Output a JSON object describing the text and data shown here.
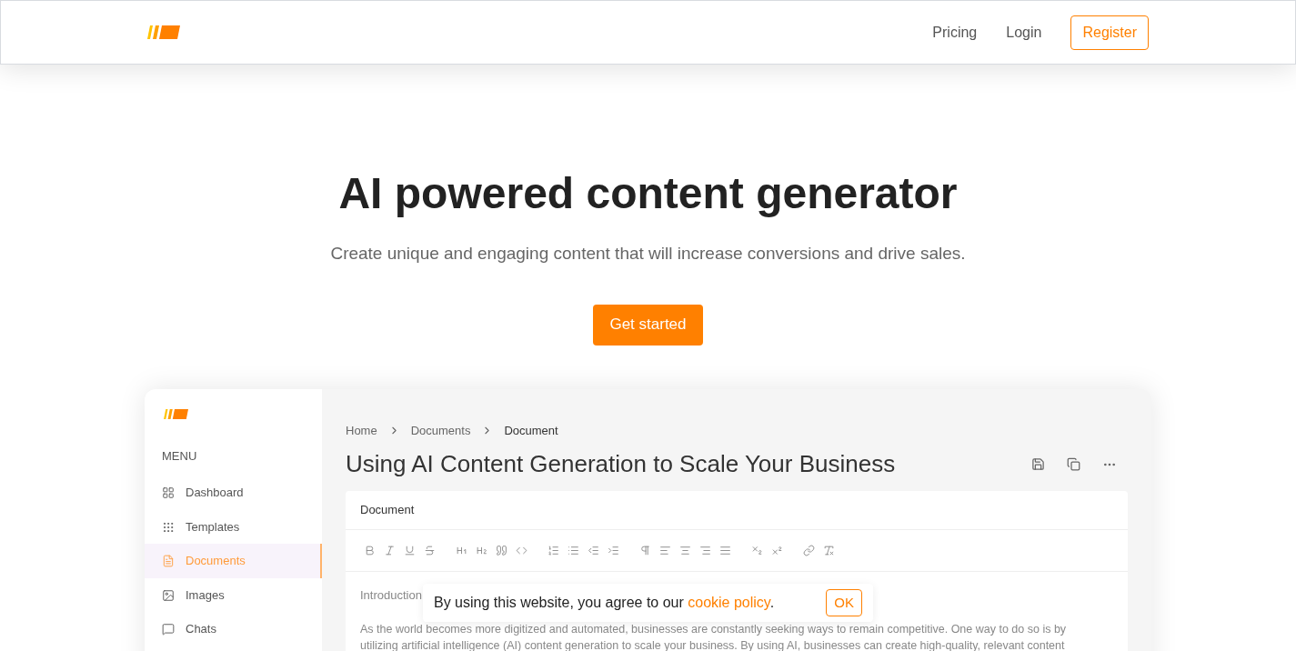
{
  "nav": {
    "links": [
      "Pricing",
      "Login"
    ],
    "register": "Register"
  },
  "hero": {
    "title": "AI powered content generator",
    "subtitle": "Create unique and engaging content that will increase conversions and drive sales.",
    "cta": "Get started"
  },
  "app": {
    "menu_label": "MENU",
    "sidebar": [
      {
        "label": "Dashboard",
        "kind": "dashboard",
        "selected": false
      },
      {
        "label": "Templates",
        "kind": "templates",
        "selected": false
      },
      {
        "label": "Documents",
        "kind": "documents",
        "selected": true
      },
      {
        "label": "Images",
        "kind": "images",
        "selected": false
      },
      {
        "label": "Chats",
        "kind": "chats",
        "selected": false
      }
    ],
    "breadcrumb": [
      "Home",
      "Documents",
      "Document"
    ],
    "title": "Using AI Content Generation to Scale Your Business",
    "editor": {
      "label": "Document",
      "section": "Introduction",
      "lines": [
        "As the world becomes more digitized and automated, businesses are constantly seeking ways to remain competitive. One way to do so is by",
        "utilizing artificial intelligence (AI) content generation to scale your business. By using AI, businesses can create high-quality, relevant content"
      ]
    }
  },
  "cookie": {
    "before": "By using this website, you agree to our ",
    "link": "cookie policy",
    "after": ".",
    "button": "OK"
  }
}
